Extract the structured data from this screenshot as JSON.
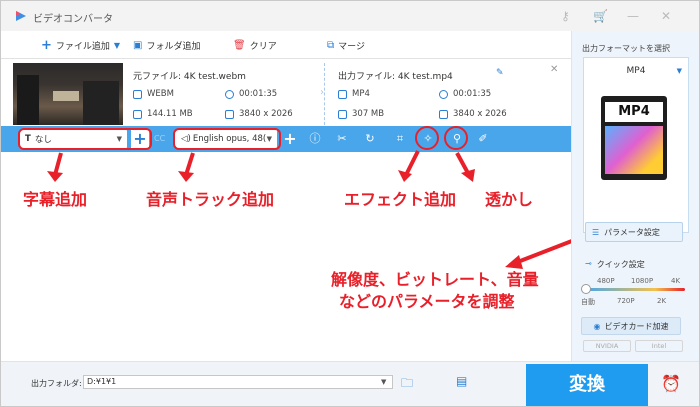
{
  "app": {
    "title": "ビデオコンバータ"
  },
  "toolbar": {
    "add_file": "ファイル追加",
    "add_folder": "フォルダ追加",
    "clear": "クリア",
    "merge": "マージ"
  },
  "file": {
    "source_label": "元ファイル:",
    "source_name": "4K test.webm",
    "output_label": "出力ファイル:",
    "output_name": "4K test.mp4",
    "src_format": "WEBM",
    "src_duration": "00:01:35",
    "src_size": "144.11 MB",
    "src_resolution": "3840 x 2026",
    "out_format": "MP4",
    "out_duration": "00:01:35",
    "out_size": "307 MB",
    "out_resolution": "3840 x 2026"
  },
  "editbar": {
    "subtitle_value": "なし",
    "audio_value": "English opus, 48(",
    "cc_label": "CC"
  },
  "annotations": {
    "subtitle": "字幕追加",
    "audio": "音声トラック追加",
    "effect": "エフェクト追加",
    "watermark": "透かし",
    "params_line1": "解像度、ビットレート、音量",
    "params_line2": "などのパラメータを調整"
  },
  "format_panel": {
    "label": "出力フォーマットを選択",
    "selected": "MP4",
    "icon_text": "MP4",
    "param_button": "パラメータ設定",
    "quick_setting": "クイック設定",
    "slider_top": [
      "480P",
      "1080P",
      "4K"
    ],
    "slider_bottom": [
      "自動",
      "720P",
      "2K"
    ],
    "gpu_button": "ビデオカード加速",
    "gpu_logos": [
      "NVIDIA",
      "Intel"
    ]
  },
  "bottom": {
    "output_folder_label": "出力フォルダ:",
    "output_path": "D:¥1¥1",
    "convert_button": "変換"
  },
  "colors": {
    "accent": "#2a7fd4",
    "toolbar_blue": "#4aa6ea",
    "annotation_red": "#e8202a",
    "convert_blue": "#1f9cf0"
  }
}
